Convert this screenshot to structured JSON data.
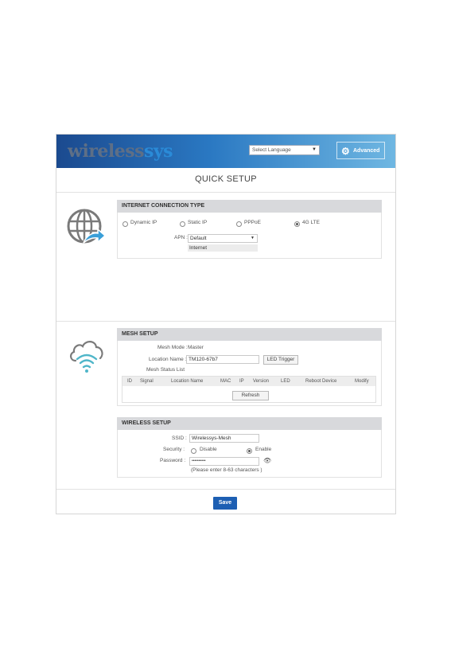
{
  "header": {
    "logo_part1": "wireless",
    "logo_part2": "sys",
    "language_select": "Select Language",
    "advanced_label": "Advanced"
  },
  "page_title": "QUICK SETUP",
  "internet": {
    "heading": "INTERNET CONNECTION TYPE",
    "options": [
      "Dynamic IP",
      "Static IP",
      "PPPoE",
      "4G LTE"
    ],
    "selected": "4G LTE",
    "apn_label": "APN :",
    "apn_value": "Default",
    "apn_option": "Internet"
  },
  "mesh": {
    "heading": "MESH SETUP",
    "mode_label": "Mesh Mode :",
    "mode_value": "Master",
    "location_label": "Location Name :",
    "location_value": "TM120-67b7",
    "led_trigger": "LED Trigger",
    "status_list_label": "Mesh Status List",
    "columns": [
      "ID",
      "Signal",
      "Location Name",
      "MAC",
      "IP",
      "Version",
      "LED",
      "Reboot Device",
      "Modify"
    ],
    "refresh": "Refresh"
  },
  "wireless": {
    "heading": "WIRELESS SETUP",
    "ssid_label": "SSID :",
    "ssid_value": "Wirelessys-Mesh",
    "security_label": "Security :",
    "security_options": [
      "Disable",
      "Enable"
    ],
    "security_selected": "Enable",
    "password_label": "Password :",
    "password_value": "••••••••••",
    "password_hint": "(Please enter 8-63 characters )"
  },
  "save_label": "Save",
  "colors": {
    "header_gradient_start": "#1b4a8f",
    "header_gradient_end": "#6fb7e2",
    "save_button": "#1d5fb3",
    "panel_header": "#d8d9dc",
    "globe_icon": "#7a7a7a",
    "globe_arrow": "#3a9fd8",
    "cloud_wifi_icon": "#4fb6c9"
  }
}
